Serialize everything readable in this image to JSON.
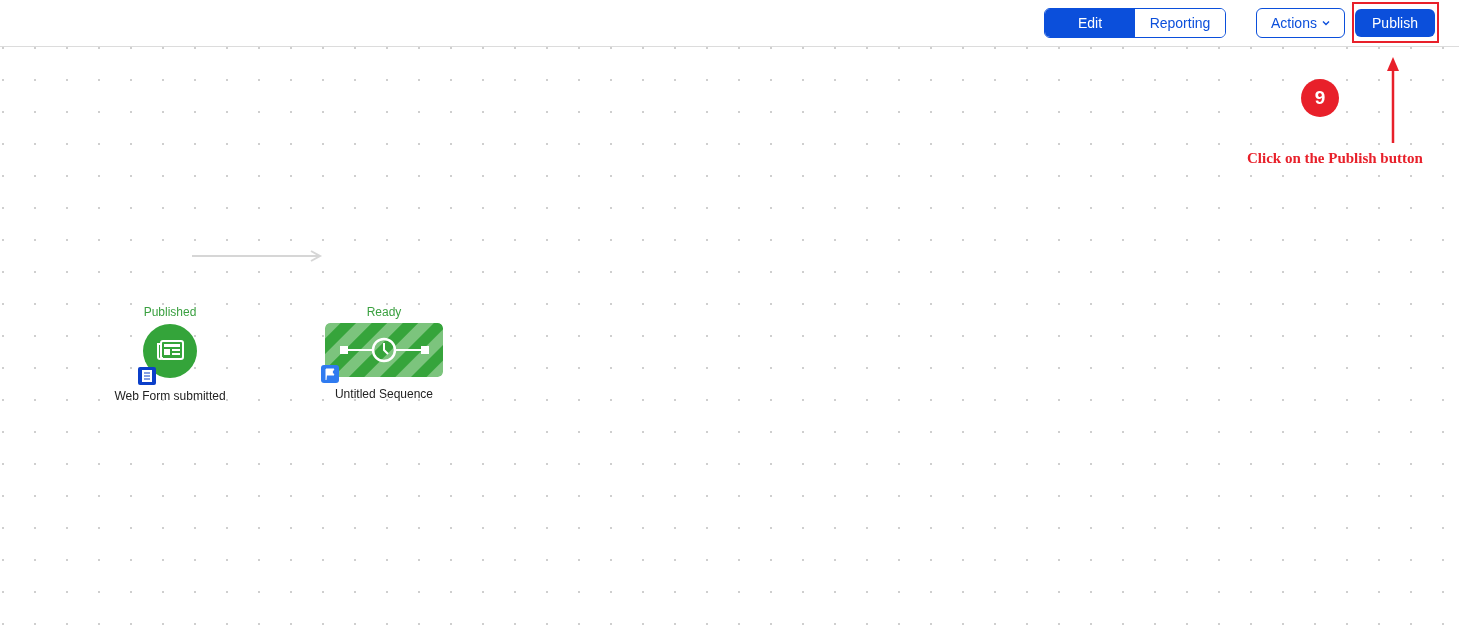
{
  "toolbar": {
    "view_tabs": [
      {
        "label": "Edit",
        "selected": true
      },
      {
        "label": "Reporting",
        "selected": false
      }
    ],
    "actions_button": {
      "label": "Actions"
    },
    "publish_button": {
      "label": "Publish"
    }
  },
  "canvas": {
    "nodes": [
      {
        "kind": "trigger",
        "status": "Published",
        "label": "Web Form submitted"
      },
      {
        "kind": "sequence",
        "status": "Ready",
        "label": "Untitled Sequence"
      }
    ]
  },
  "annotation": {
    "step": "9",
    "text": "Click on the Publish button"
  }
}
